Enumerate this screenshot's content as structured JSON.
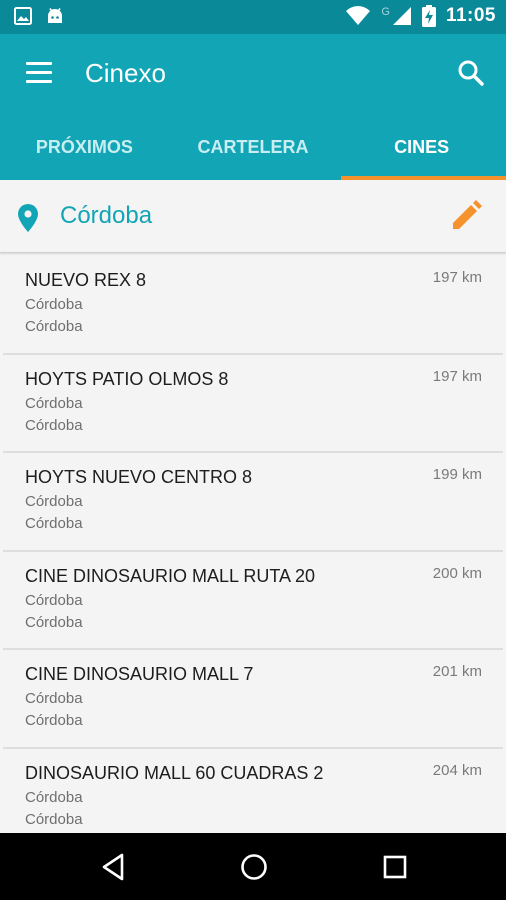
{
  "status_bar": {
    "time": "11:05",
    "network_letter": "G",
    "icons": [
      "image-icon",
      "android-icon",
      "wifi-icon",
      "signal-icon",
      "battery-charging-icon"
    ]
  },
  "app_bar": {
    "title": "Cinexo",
    "menu_icon": "hamburger-menu-icon",
    "search_icon": "search-icon"
  },
  "tabs": [
    {
      "label": "PRÓXIMOS",
      "active": false
    },
    {
      "label": "CARTELERA",
      "active": false
    },
    {
      "label": "CINES",
      "active": true
    }
  ],
  "location": {
    "name": "Córdoba",
    "icon": "location-pin-icon",
    "edit_icon": "pencil-edit-icon"
  },
  "cinemas": [
    {
      "name": "NUEVO REX 8",
      "city": "Córdoba",
      "province": "Córdoba",
      "distance": "197 km"
    },
    {
      "name": "HOYTS PATIO OLMOS 8",
      "city": "Córdoba",
      "province": "Córdoba",
      "distance": "197 km"
    },
    {
      "name": "HOYTS NUEVO CENTRO 8",
      "city": "Córdoba",
      "province": "Córdoba",
      "distance": "199 km"
    },
    {
      "name": "CINE DINOSAURIO MALL RUTA 20",
      "city": "Córdoba",
      "province": "Córdoba",
      "distance": "200 km"
    },
    {
      "name": "CINE DINOSAURIO MALL 7",
      "city": "Córdoba",
      "province": "Córdoba",
      "distance": "201 km"
    },
    {
      "name": "DINOSAURIO MALL 60 CUADRAS 2",
      "city": "Córdoba",
      "province": "Córdoba",
      "distance": "204 km"
    }
  ],
  "nav_bar": {
    "buttons": [
      "back-icon",
      "home-icon",
      "recents-icon"
    ]
  },
  "colors": {
    "status_bar": "#0a8a99",
    "primary": "#12a5b5",
    "accent": "#f6922b",
    "background": "#f4f4f4"
  }
}
